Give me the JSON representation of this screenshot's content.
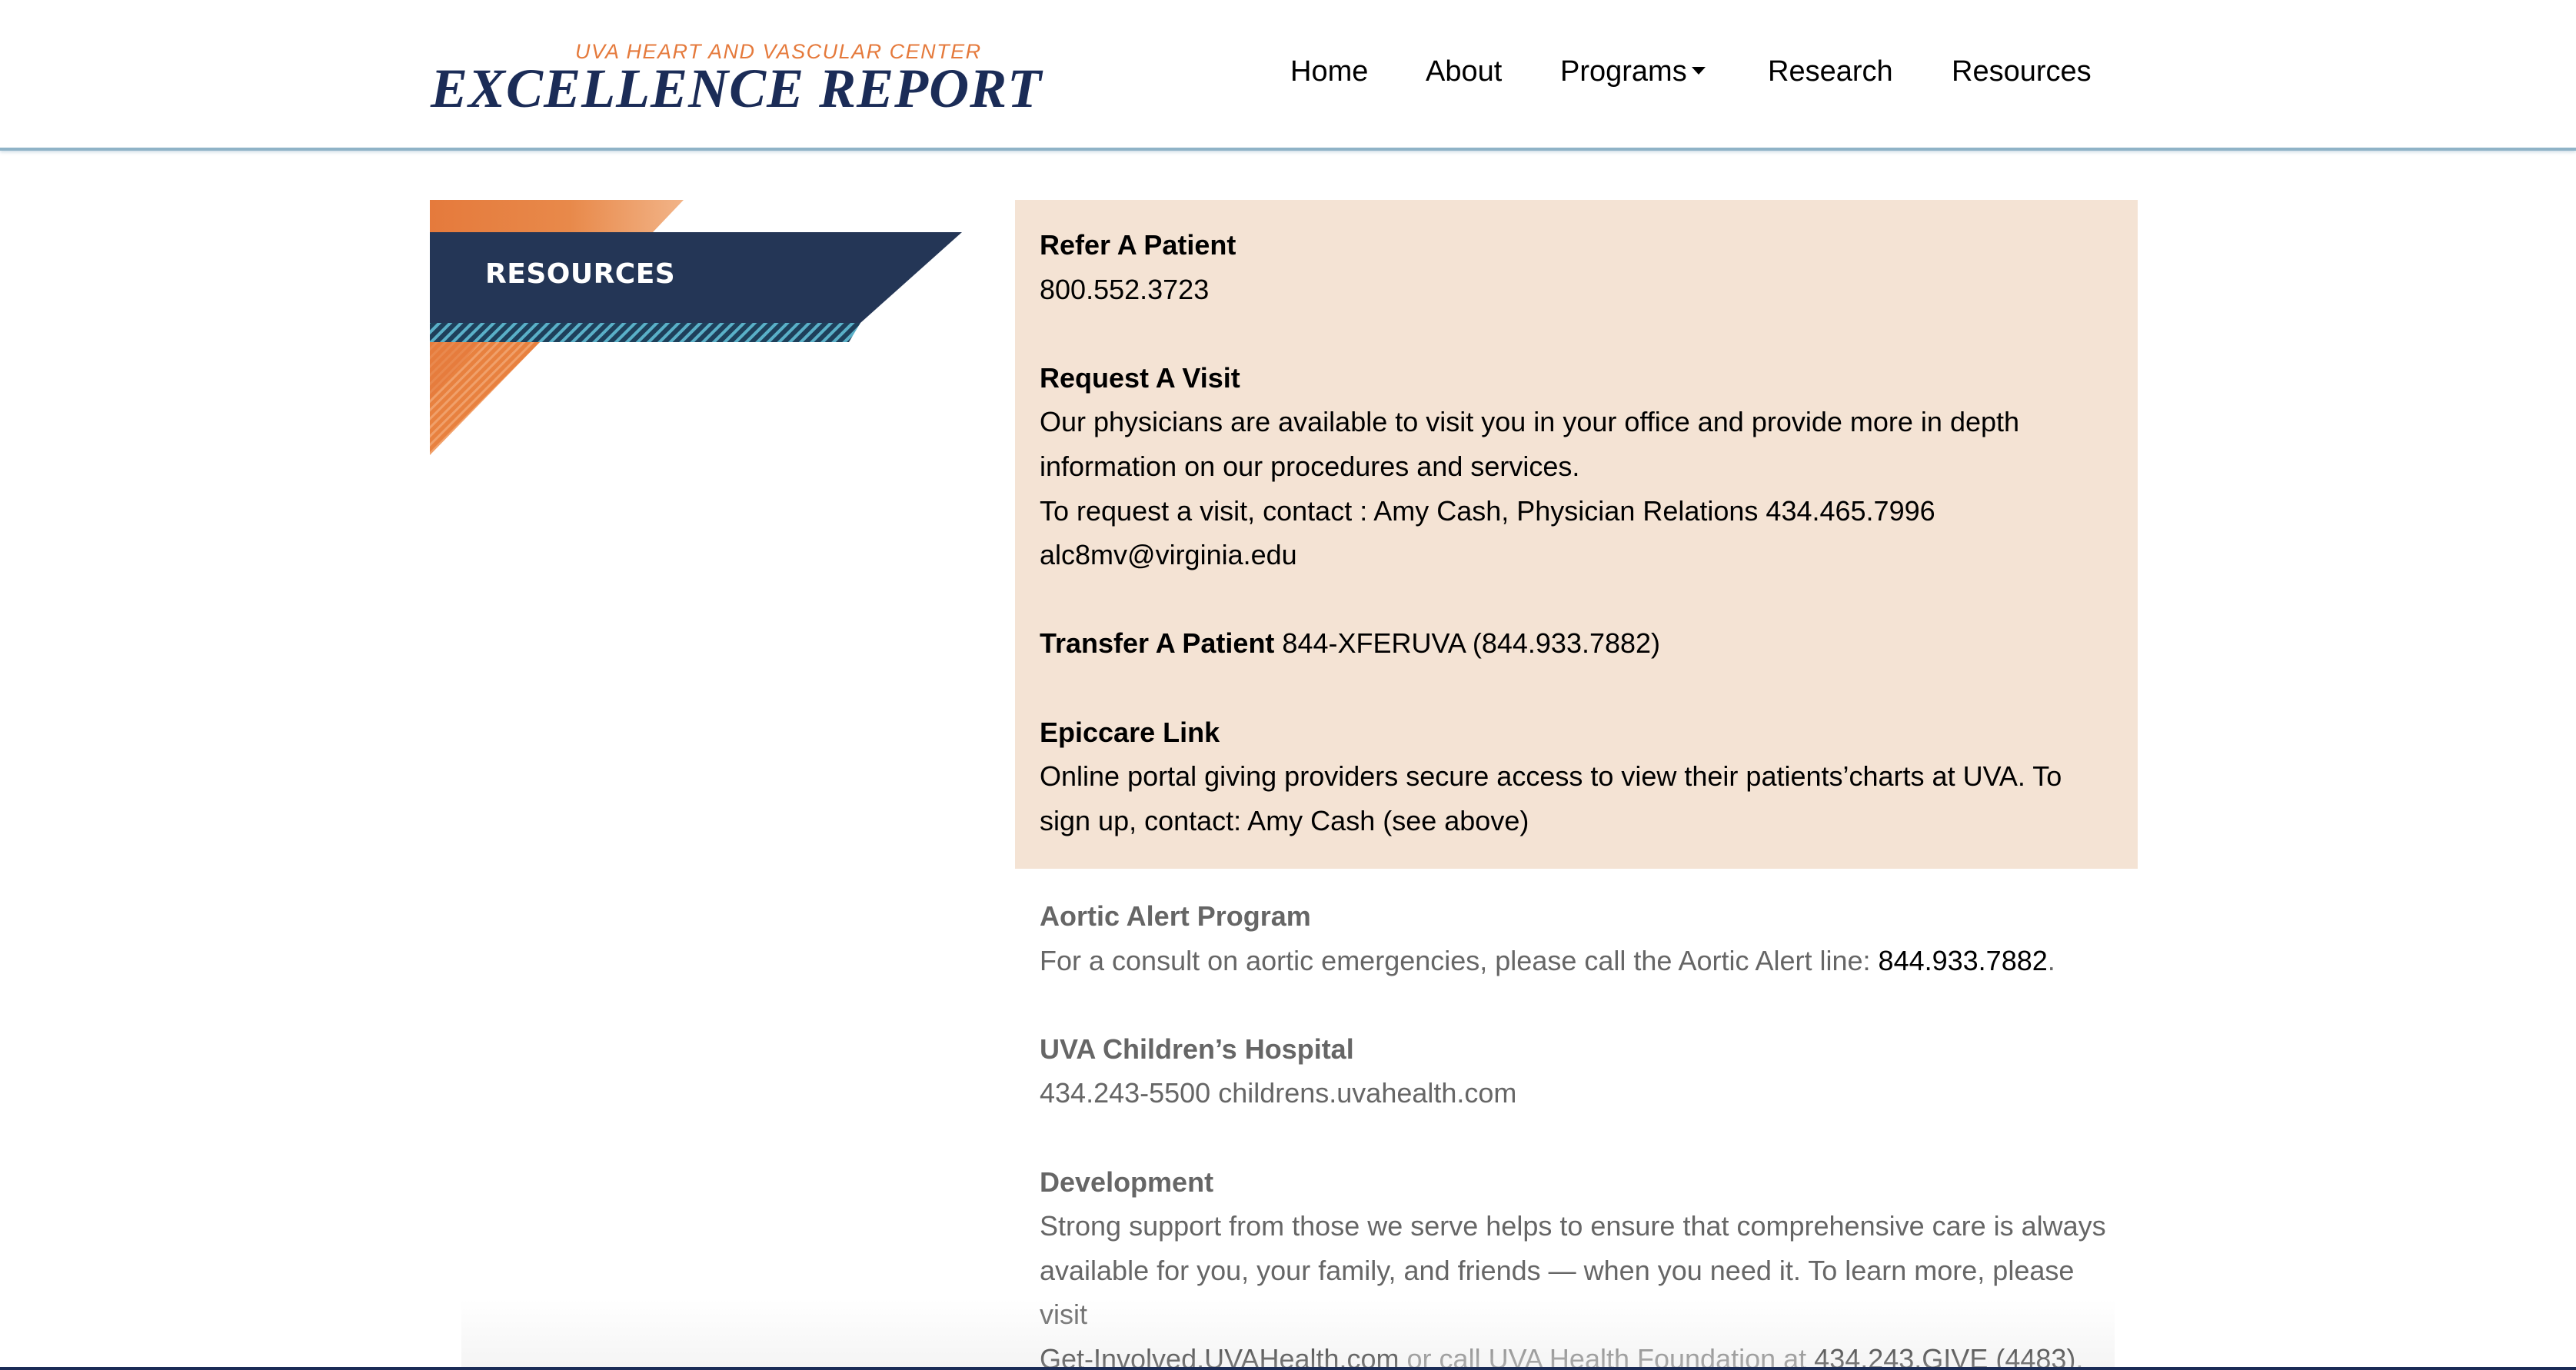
{
  "header": {
    "brand_kicker": "UVA HEART AND VASCULAR CENTER",
    "brand_title": "EXCELLENCE REPORT",
    "nav": {
      "home": "Home",
      "about": "About",
      "programs": "Programs",
      "research": "Research",
      "resources": "Resources"
    }
  },
  "sidebar": {
    "banner_title": "RESOURCES"
  },
  "highlight": {
    "refer_title": "Refer A Patient",
    "refer_phone": "800.552.3723",
    "visit_title": "Request A Visit",
    "visit_line1": "Our physicians are available to visit you in your office and provide more in depth",
    "visit_line2": "information on our procedures and services.",
    "visit_line3": "To request a visit, contact : Amy Cash, Physician Relations 434.465.7996",
    "visit_email": "alc8mv@virginia.edu",
    "transfer_title": "Transfer A Patient",
    "transfer_detail": " 844-XFERUVA (844.933.7882)",
    "epic_title": "Epiccare Link",
    "epic_line1": "Online portal giving providers secure access to view their patients’charts at UVA. To",
    "epic_line2": "sign up, contact: Amy Cash (see above)"
  },
  "content": {
    "aortic_title": "Aortic Alert Program",
    "aortic_text": "For a consult on aortic emergencies, please call the Aortic Alert line: ",
    "aortic_phone": "844.933.7882",
    "aortic_end": ".",
    "childrens_title": "UVA Children’s Hospital",
    "childrens_line": "434.243-5500 childrens.uvahealth.com",
    "dev_title": "Development",
    "dev_line1": "Strong support from those we serve helps to ensure that comprehensive care is always",
    "dev_line2": "available for you, your family, and friends — when you need it. To learn more, please",
    "dev_line3": "visit",
    "dev_link": "Get-Involved.UVAHealth.com",
    "dev_mid": " or call UVA Health Foundation at ",
    "dev_phone": "434.243.GIVE (4483)",
    "dev_end": "."
  },
  "colors": {
    "navy": "#1b2c57",
    "orange": "#e57a3c",
    "highlight_bg": "#f4e3d4",
    "banner_navy": "#243656",
    "stripe_teal": "#5ab0c8"
  }
}
